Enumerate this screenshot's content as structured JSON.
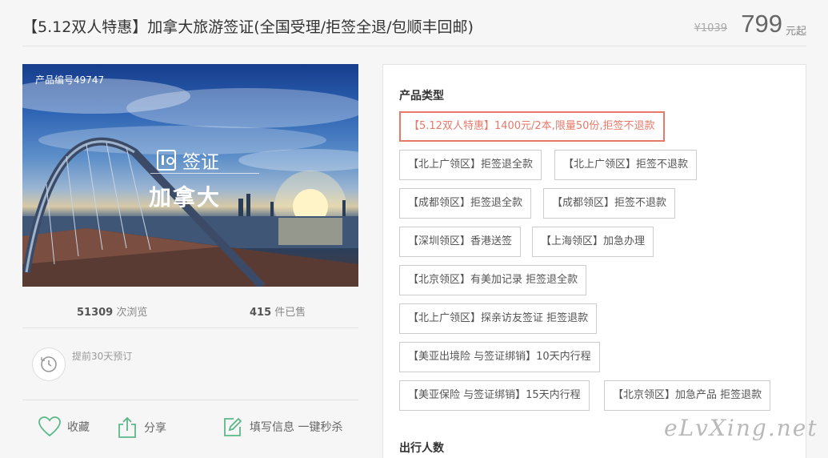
{
  "header": {
    "title": "【5.12双人特惠】加拿大旅游签证(全国受理/拒签全退/包顺丰回邮)",
    "original_price": "¥1039",
    "price": "799",
    "price_unit": "元起"
  },
  "hero": {
    "product_number": "产品编号49747",
    "visa_label": "签证",
    "country": "加拿大"
  },
  "stats": {
    "views_count": "51309",
    "views_label": "次浏览",
    "sold_count": "415",
    "sold_label": "件已售"
  },
  "advance": {
    "text": "提前30天预订"
  },
  "actions": {
    "favorite": "收藏",
    "share": "分享",
    "fill_info": "填写信息 一键秒杀"
  },
  "panel": {
    "product_type_label": "产品类型",
    "options": [
      "【5.12双人特惠】1400元/2本,限量50份,拒签不退款",
      "【北上广领区】拒签退全款",
      "【北上广领区】拒签不退款",
      "【成都领区】拒签退全款",
      "【成都领区】拒签不退款",
      "【深圳领区】香港送签",
      "【上海领区】加急办理",
      "【北京领区】有美加记录 拒签退全款",
      "【北上广领区】探亲访友签证 拒签退款",
      "【美亚出境险 与签证绑销】10天内行程",
      "【美亚保险 与签证绑销】15天内行程",
      "【北京领区】加急产品 拒签退款"
    ],
    "selected_index": 0,
    "travelers_label": "出行人数"
  },
  "watermark": "eLvXing.net",
  "colors": {
    "accent": "#e7796a",
    "icon_green": "#5cb88a"
  }
}
